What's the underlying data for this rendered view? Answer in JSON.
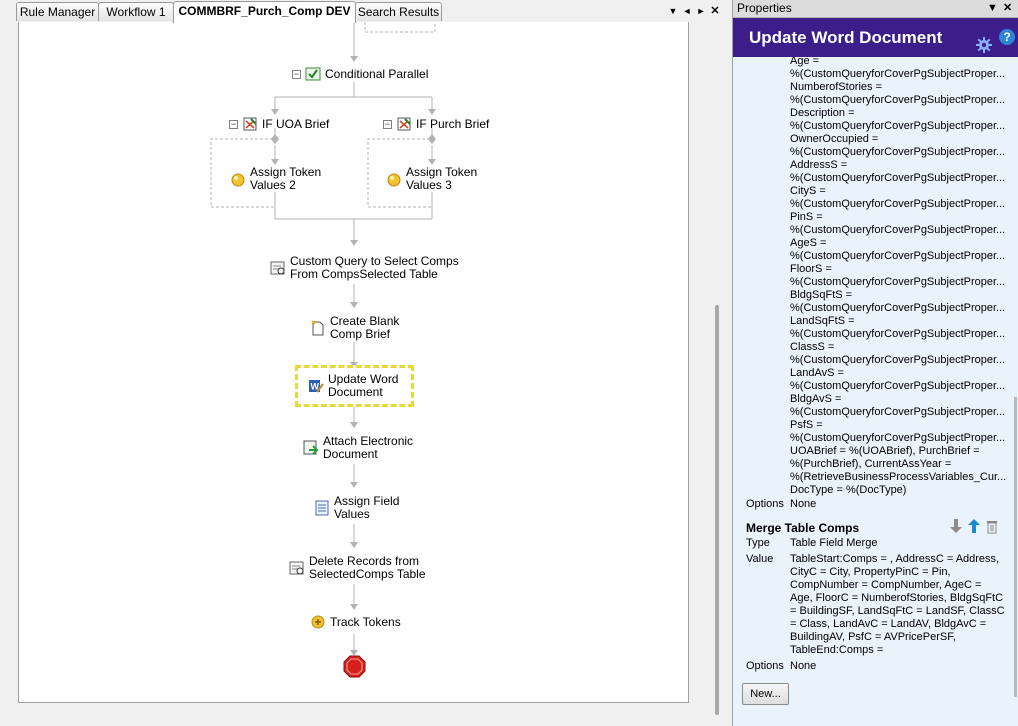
{
  "tabs": [
    {
      "label": "Rule Manager"
    },
    {
      "label": "Workflow 1"
    },
    {
      "label": "COMMBRF_Purch_Comp DEV"
    },
    {
      "label": "Search Results"
    }
  ],
  "tab_controls": {
    "dropdown": "▼",
    "prev": "◄",
    "next": "►",
    "close": "✕"
  },
  "workflow": {
    "conditional_parallel": "Conditional Parallel",
    "if_uoa": "IF UOA Brief",
    "if_purch": "IF Purch Brief",
    "assign_token_2_a": "Assign Token",
    "assign_token_2_b": "Values 2",
    "assign_token_3_a": "Assign Token",
    "assign_token_3_b": "Values 3",
    "custom_query_a": "Custom Query to Select Comps",
    "custom_query_b": "From CompsSelected Table",
    "create_blank_a": "Create Blank",
    "create_blank_b": "Comp Brief",
    "update_word_a": "Update Word",
    "update_word_b": "Document",
    "attach_a": "Attach Electronic",
    "attach_b": "Document",
    "assign_field_a": "Assign Field",
    "assign_field_b": "Values",
    "delete_a": "Delete Records from",
    "delete_b": "SelectedComps Table",
    "track": "Track Tokens",
    "expander": "−"
  },
  "properties": {
    "panel_title": "Properties",
    "header": "Update Word Document",
    "help": "?",
    "value_lines": [
      "Age =",
      "%(CustomQueryforCoverPgSubjectProper...",
      "NumberofStories =",
      "%(CustomQueryforCoverPgSubjectProper...",
      "Description =",
      "%(CustomQueryforCoverPgSubjectProper...",
      "OwnerOccupied =",
      "%(CustomQueryforCoverPgSubjectProper...",
      "AddressS =",
      "%(CustomQueryforCoverPgSubjectProper...",
      "CityS =",
      "%(CustomQueryforCoverPgSubjectProper...",
      "PinS =",
      "%(CustomQueryforCoverPgSubjectProper...",
      "AgeS =",
      "%(CustomQueryforCoverPgSubjectProper...",
      "FloorS =",
      "%(CustomQueryforCoverPgSubjectProper...",
      "BldgSqFtS =",
      "%(CustomQueryforCoverPgSubjectProper...",
      "LandSqFtS =",
      "%(CustomQueryforCoverPgSubjectProper...",
      "ClassS =",
      "%(CustomQueryforCoverPgSubjectProper...",
      "LandAvS =",
      "%(CustomQueryforCoverPgSubjectProper...",
      "BldgAvS =",
      "%(CustomQueryforCoverPgSubjectProper...",
      "PsfS =",
      "%(CustomQueryforCoverPgSubjectProper...",
      "UOABrief = %(UOABrief), PurchBrief =",
      "%(PurchBrief), CurrentAssYear =",
      "%(RetrieveBusinessProcessVariables_Cur...",
      "DocType = %(DocType)"
    ],
    "options_label": "Options",
    "options_value": "None",
    "merge_title": "Merge Table Comps",
    "type_label": "Type",
    "type_value": "Table Field Merge",
    "value_label": "Value",
    "merge_value_lines": [
      "TableStart:Comps = , AddressC = Address,",
      "CityC = City, PropertyPinC = Pin,",
      "CompNumber = CompNumber, AgeC =",
      "Age, FloorC = NumberofStories, BldgSqFtC",
      "= BuildingSF, LandSqFtC = LandSF, ClassC",
      "= Class, LandAvC = LandAV, BldgAvC =",
      "BuildingAV, PsfC = AVPricePerSF,",
      "TableEnd:Comps ="
    ],
    "options2_label": "Options",
    "options2_value": "None",
    "new_button": "New..."
  },
  "colors": {
    "header_bg": "#3b1e8a",
    "panel_bg": "#eaf2fb",
    "selection_border": "#e8d83a"
  }
}
